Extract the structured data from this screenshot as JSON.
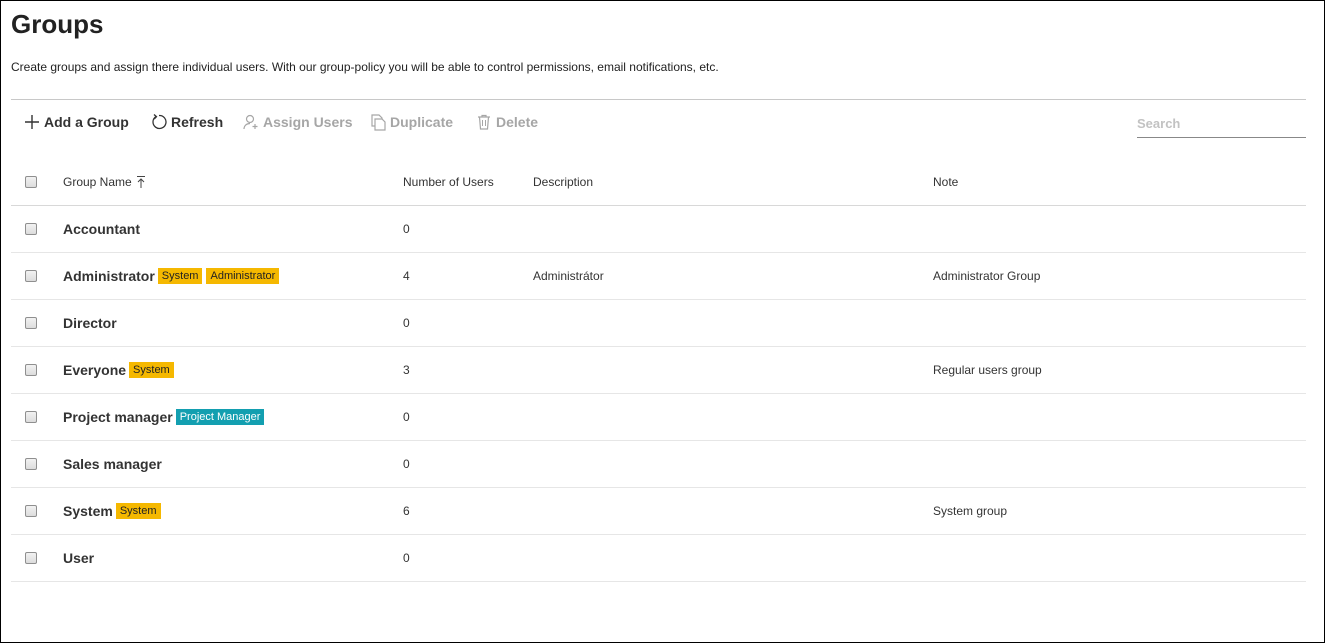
{
  "page": {
    "title": "Groups",
    "description": "Create groups and assign there individual users. With our group-policy you will be able to control permissions, email notifications, etc."
  },
  "toolbar": {
    "add_label": "Add a Group",
    "refresh_label": "Refresh",
    "assign_label": "Assign Users",
    "duplicate_label": "Duplicate",
    "delete_label": "Delete",
    "search_placeholder": "Search"
  },
  "columns": {
    "name": "Group Name",
    "users": "Number of Users",
    "description": "Description",
    "note": "Note"
  },
  "colors": {
    "badge_yellow": "#f5b800",
    "badge_teal": "#139fb0",
    "disabled_text": "#a6a6a6"
  },
  "rows": [
    {
      "name": "Accountant",
      "users": "0",
      "description": "",
      "note": "",
      "badges": []
    },
    {
      "name": "Administrator",
      "users": "4",
      "description": "Administrátor",
      "note": "Administrator Group",
      "badges": [
        {
          "label": "System",
          "color": "yellow"
        },
        {
          "label": "Administrator",
          "color": "yellow"
        }
      ]
    },
    {
      "name": "Director",
      "users": "0",
      "description": "",
      "note": "",
      "badges": []
    },
    {
      "name": "Everyone",
      "users": "3",
      "description": "",
      "note": "Regular users group",
      "badges": [
        {
          "label": "System",
          "color": "yellow"
        }
      ]
    },
    {
      "name": "Project manager",
      "users": "0",
      "description": "",
      "note": "",
      "badges": [
        {
          "label": "Project Manager",
          "color": "teal"
        }
      ]
    },
    {
      "name": "Sales manager",
      "users": "0",
      "description": "",
      "note": "",
      "badges": []
    },
    {
      "name": "System",
      "users": "6",
      "description": "",
      "note": "System group",
      "badges": [
        {
          "label": "System",
          "color": "yellow"
        }
      ]
    },
    {
      "name": "User",
      "users": "0",
      "description": "",
      "note": "",
      "badges": []
    }
  ]
}
